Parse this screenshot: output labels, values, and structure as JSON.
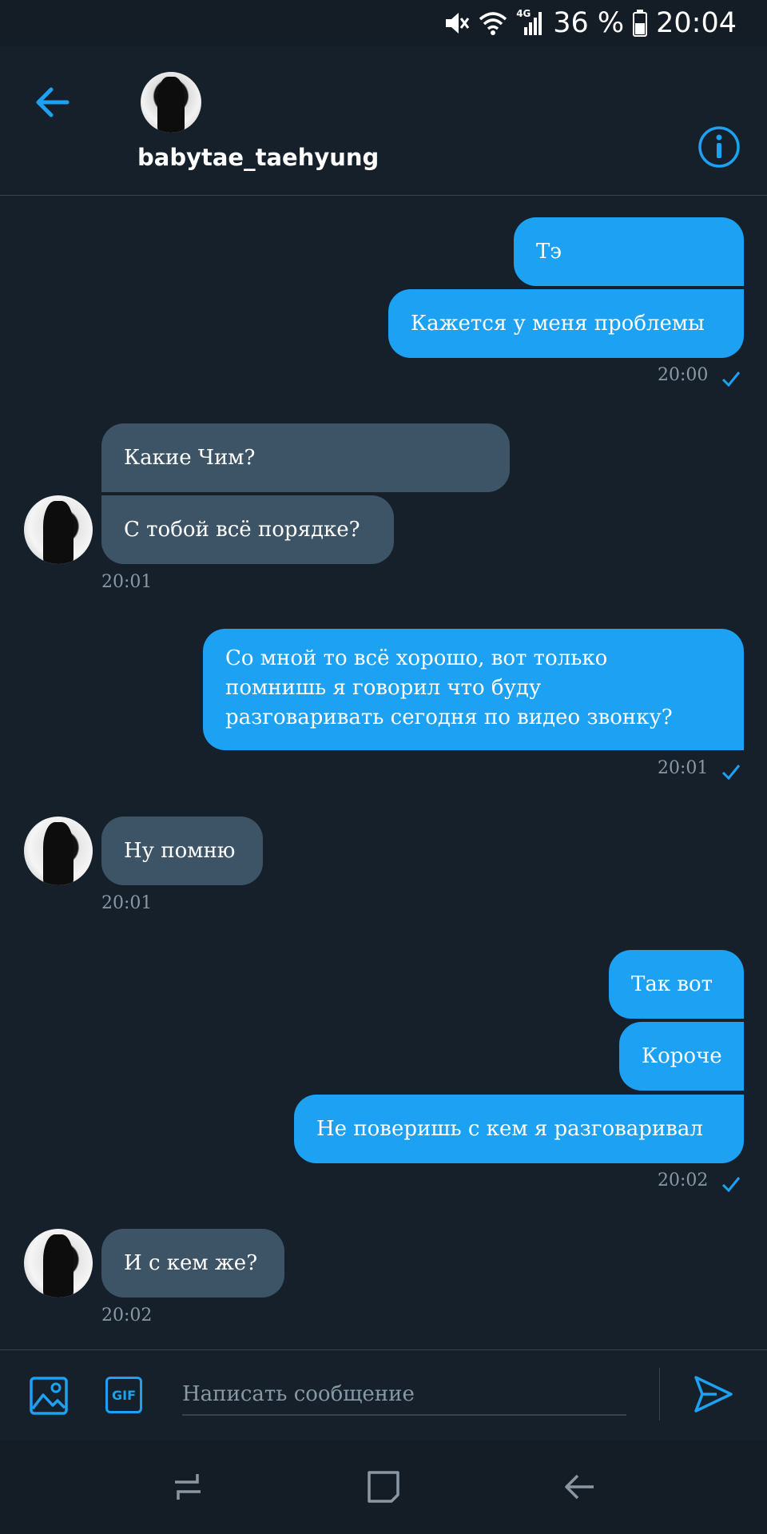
{
  "status_bar": {
    "icons": [
      "mute-icon",
      "wifi-icon",
      "signal-4g-icon",
      "battery-icon"
    ],
    "network_label": "4G",
    "battery_percent": "36 %",
    "time": "20:04"
  },
  "header": {
    "username": "babytae_taehyung",
    "back_icon": "arrow-left-icon",
    "info_icon": "info-icon"
  },
  "colors": {
    "background": "#15202b",
    "accent": "#1da1f2",
    "incoming_bubble": "#3d5466",
    "muted_text": "#8899a6",
    "divider": "#38444d"
  },
  "messages": [
    {
      "direction": "out",
      "text": "Тэ"
    },
    {
      "direction": "out",
      "text": "Кажется у меня проблемы"
    },
    {
      "direction": "out",
      "time": "20:00",
      "status": "read"
    },
    {
      "direction": "in",
      "text": "Какие Чим?"
    },
    {
      "direction": "in",
      "text": "С тобой всё порядке?"
    },
    {
      "direction": "in",
      "time": "20:01"
    },
    {
      "direction": "out",
      "lines": [
        "Со мной то всё хорошо, вот только",
        "помнишь я говорил что буду",
        "разговаривать сегодня по видео звонку?"
      ]
    },
    {
      "direction": "out",
      "time": "20:01",
      "status": "read"
    },
    {
      "direction": "in",
      "text": "Ну помню"
    },
    {
      "direction": "in",
      "time": "20:01"
    },
    {
      "direction": "out",
      "text": "Так вот"
    },
    {
      "direction": "out",
      "text": "Короче"
    },
    {
      "direction": "out",
      "text": "Не поверишь с кем я разговаривал"
    },
    {
      "direction": "out",
      "time": "20:02",
      "status": "read"
    },
    {
      "direction": "in",
      "text": "И с кем же?"
    },
    {
      "direction": "in",
      "time": "20:02"
    }
  ],
  "composer": {
    "placeholder": "Написать сообщение",
    "value": "",
    "image_icon": "image-icon",
    "gif_label": "GIF",
    "send_icon": "send-icon"
  },
  "nav_bar": {
    "items": [
      "recent-apps-icon",
      "home-icon",
      "back-icon"
    ]
  }
}
